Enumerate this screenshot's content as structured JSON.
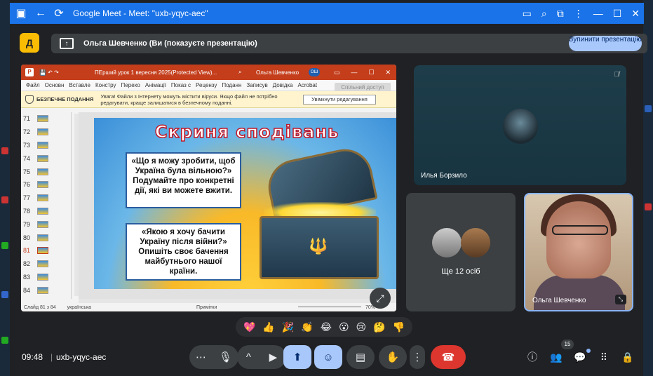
{
  "window": {
    "title": "Google Meet - Meet: \"uxb-yqyc-aec\""
  },
  "presenting": {
    "label": "Ольга Шевченко (Ви (показуєте презентацію)",
    "stop_button": "Зупинити презентацію"
  },
  "ppt": {
    "file_name": "ПЕрший урок 1 вересня 2025(Protected View)...",
    "user_name": "Ольга Шевченко",
    "avatar_initials": "ОШ",
    "menu": [
      "Файл",
      "Основн",
      "Вставле",
      "Констру",
      "Перехо",
      "Анімації",
      "Показ с",
      "Рецензу",
      "Поданн",
      "Записув",
      "Довідка",
      "Acrobat"
    ],
    "share_button": "Спільний доступ",
    "protected_label": "БЕЗПЕЧНЕ ПОДАННЯ",
    "protected_text": "Увага! Файли з Інтернету можуть містити віруси. Якщо файл не потрібно редагувати, краще залишатися в безпечному поданні.",
    "enable_editing": "Увімкнути редагування",
    "slide_numbers": [
      "71",
      "72",
      "73",
      "74",
      "75",
      "76",
      "77",
      "78",
      "79",
      "80",
      "81",
      "82",
      "83",
      "84"
    ],
    "active_slide": "81",
    "slide": {
      "title": "Скриня сподівань",
      "question1": "«Що я можу зробити, щоб Україна була вільною?» Подумайте про конкретні дії, які ви можете вжити.",
      "question2": "«Якою я хочу бачити Україну після війни?» Опишіть своє бачення майбутнього нашої країни."
    },
    "status": {
      "slide_of": "Слайд 81 з 84",
      "language": "українська",
      "notes": "Примітки",
      "zoom": "70%"
    }
  },
  "participants": {
    "tile1_name": "Илья Борзило",
    "more_label": "Ще 12 осіб",
    "self_name": "Ольга Шевченко"
  },
  "reactions": [
    "💖",
    "👍",
    "🎉",
    "👏",
    "😂",
    "😮",
    "😢",
    "🤔",
    "👎"
  ],
  "bottom": {
    "time": "09:48",
    "separator": "|",
    "meeting_code": "uxb-yqyc-aec",
    "people_count": "15"
  },
  "colors": {
    "accent": "#1a73e8",
    "present_active": "#a8c7fa",
    "end_call": "#dc362e",
    "ppt_brand": "#c43e1c"
  }
}
